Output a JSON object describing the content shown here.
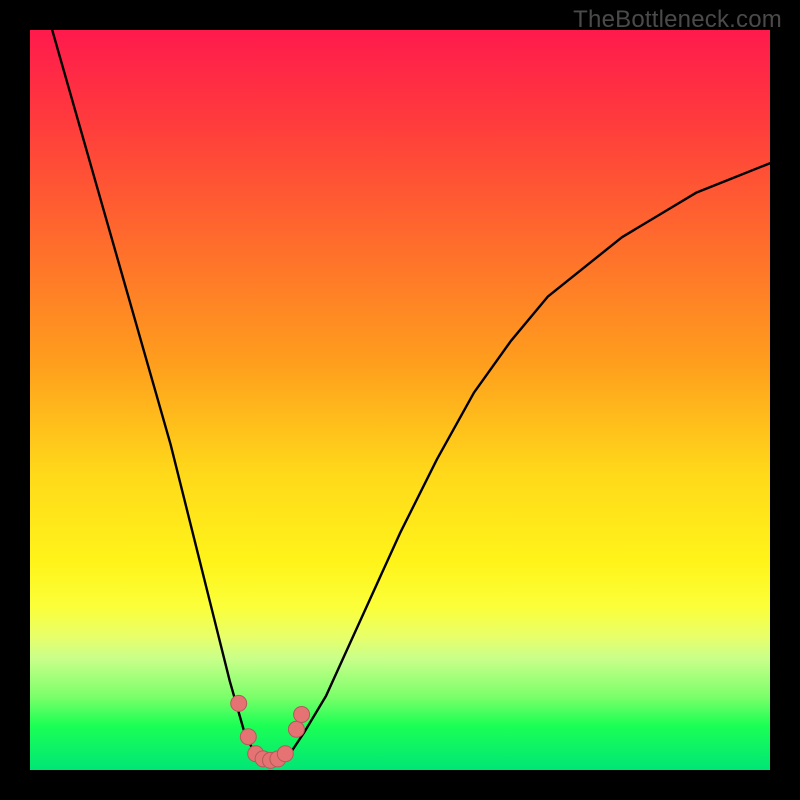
{
  "watermark": "TheBottleneck.com",
  "colors": {
    "frame": "#000000",
    "curve": "#000000",
    "marker_fill": "#e57373",
    "marker_stroke": "#b35a5a",
    "gradient_top": "#ff1a4d",
    "gradient_bottom": "#00e676"
  },
  "chart_data": {
    "type": "line",
    "title": "",
    "xlabel": "",
    "ylabel": "",
    "xlim": [
      0,
      100
    ],
    "ylim": [
      0,
      100
    ],
    "series": [
      {
        "name": "curve",
        "x": [
          3,
          5,
          7,
          9,
          11,
          13,
          15,
          17,
          19,
          21,
          23,
          25,
          27,
          29,
          30,
          31,
          32,
          33,
          34,
          35,
          37,
          40,
          45,
          50,
          55,
          60,
          65,
          70,
          75,
          80,
          85,
          90,
          95,
          100
        ],
        "y": [
          100,
          93,
          86,
          79,
          72,
          65,
          58,
          51,
          44,
          36,
          28,
          20,
          12,
          5,
          3,
          2,
          1.5,
          1.2,
          1.5,
          2,
          5,
          10,
          21,
          32,
          42,
          51,
          58,
          64,
          68,
          72,
          75,
          78,
          80,
          82
        ]
      }
    ],
    "markers": {
      "x": [
        28.2,
        29.5,
        30.5,
        31.5,
        32.5,
        33.5,
        34.5,
        36.0,
        36.7
      ],
      "y": [
        9,
        4.5,
        2.2,
        1.5,
        1.3,
        1.5,
        2.2,
        5.5,
        7.5
      ],
      "r": [
        8,
        8,
        8,
        8,
        8,
        8,
        8,
        8,
        8
      ]
    }
  }
}
